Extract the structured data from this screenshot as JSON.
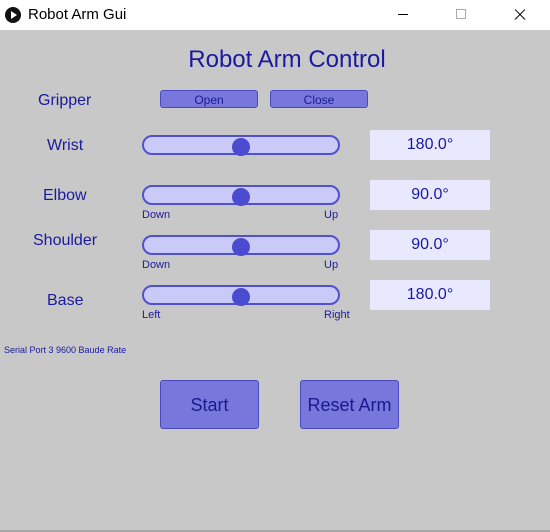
{
  "window": {
    "title": "Robot Arm Gui"
  },
  "main": {
    "title": "Robot Arm Control"
  },
  "gripper": {
    "label": "Gripper",
    "open_label": "Open",
    "close_label": "Close"
  },
  "sliders": [
    {
      "label": "Wrist",
      "value_text": "180.0°",
      "fraction": 0.5,
      "min_label": "",
      "max_label": ""
    },
    {
      "label": "Elbow",
      "value_text": "90.0°",
      "fraction": 0.5,
      "min_label": "Down",
      "max_label": "Up"
    },
    {
      "label": "Shoulder",
      "value_text": "90.0°",
      "fraction": 0.5,
      "min_label": "Down",
      "max_label": "Up"
    },
    {
      "label": "Base",
      "value_text": "180.0°",
      "fraction": 0.5,
      "min_label": "Left",
      "max_label": "Right"
    }
  ],
  "status": {
    "serial": "Serial Port 3   9600 Baude Rate"
  },
  "actions": {
    "start_label": "Start",
    "reset_label": "Reset Arm"
  },
  "colors": {
    "accent": "#7878dc",
    "text": "#1a1aa0",
    "background": "#c8c8c8"
  }
}
